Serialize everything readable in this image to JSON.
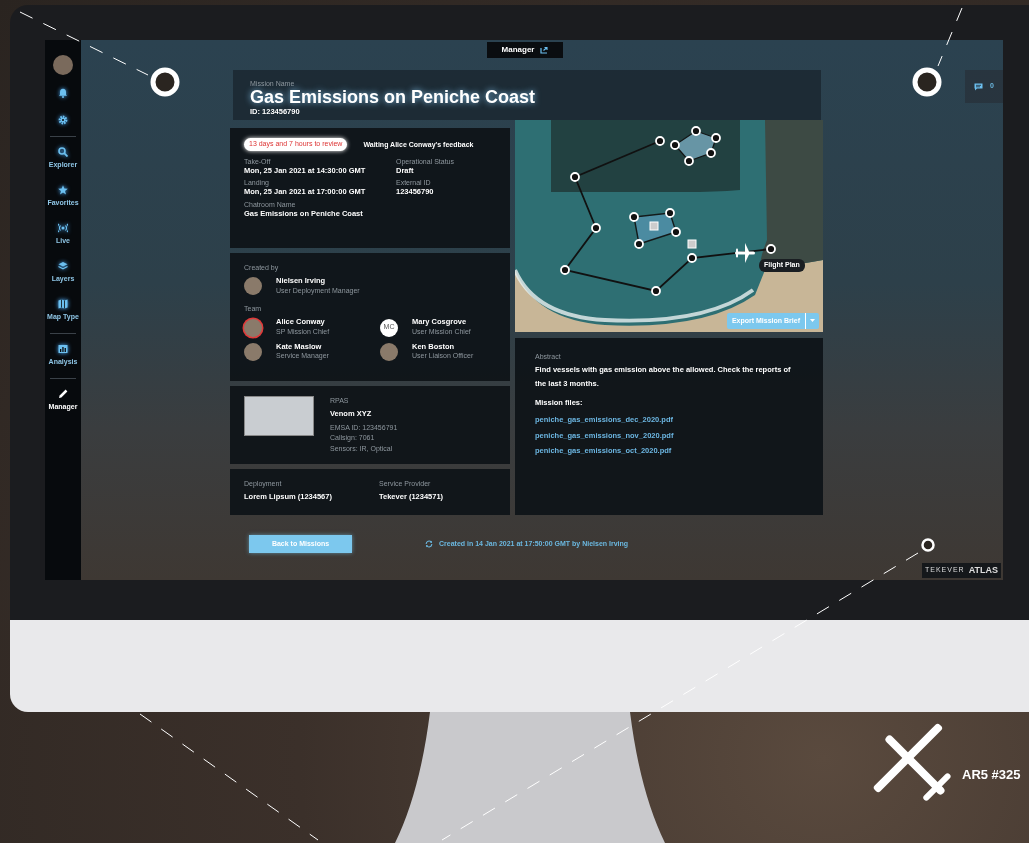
{
  "sidebar": {
    "items": [
      {
        "label": "Explorer",
        "selected": false
      },
      {
        "label": "Favorites",
        "selected": false
      },
      {
        "label": "Live",
        "selected": false
      },
      {
        "label": "Layers",
        "selected": false
      },
      {
        "label": "Map Type",
        "selected": false
      },
      {
        "label": "Analysis",
        "selected": false
      },
      {
        "label": "Manager",
        "selected": true
      }
    ]
  },
  "top_tab": {
    "label": "Manager"
  },
  "comments": {
    "count": "0"
  },
  "mission": {
    "name_label": "Mission Name",
    "name": "Gas Emissions on Peniche Coast",
    "id": "ID: 123456790"
  },
  "review": {
    "badge": "13 days and 7 hours to review",
    "status": "Waiting Alice Conway's feedback"
  },
  "details": [
    {
      "label": "Take-Off",
      "value": "Mon, 25 Jan 2021 at 14:30:00 GMT"
    },
    {
      "label": "Operational Status",
      "value": "Draft"
    },
    {
      "label": "Landing",
      "value": "Mon, 25 Jan 2021 at 17:00:00 GMT"
    },
    {
      "label": "External ID",
      "value": "123456790"
    },
    {
      "label": "Chatroom Name",
      "value": "Gas Emissions on Peniche Coast"
    }
  ],
  "created_by": {
    "label": "Created by",
    "name": "Nielsen Irving",
    "role": "User Deployment Manager"
  },
  "team": {
    "label": "Team",
    "members": [
      {
        "name": "Alice Conway",
        "role": "SP Mission Chief",
        "pending": true
      },
      {
        "name": "Mary Cosgrove",
        "role": "User Mission Chief",
        "initials": "MC",
        "pending": false
      },
      {
        "name": "Kate Maslow",
        "role": "Service Manager",
        "pending": false
      },
      {
        "name": "Ken Boston",
        "role": "User Liaison Officer",
        "pending": false
      }
    ]
  },
  "rpas": {
    "label": "RPAS",
    "name": "Venom XYZ",
    "lines": [
      "EMSA ID: 123456791",
      "Callsign: 7061",
      "Sensors: IR, Optical"
    ]
  },
  "deployment": [
    {
      "label": "Deployment",
      "value": "Lorem Lipsum  (1234567)"
    },
    {
      "label": "Service Provider",
      "value": "Tekever (1234571)"
    }
  ],
  "map": {
    "label": "Flight Plan",
    "export_button": "Export Mission Brief"
  },
  "abstract": {
    "label": "Abstract",
    "text": "Find vessels with gas emission above the allowed. Check the reports of the last 3 months.",
    "files_label": "Mission files:",
    "files": [
      "peniche_gas_emissions_dec_2020.pdf",
      "peniche_gas_emissions_nov_2020.pdf",
      "peniche_gas_emissions_oct_2020.pdf"
    ]
  },
  "footer": {
    "back_button": "Back to Missions",
    "created": "Created in 14 Jan 2021 at 17:50:00 GMT by Nielsen Irving"
  },
  "brand": {
    "logo": "TEKEVER",
    "product": "ATLAS"
  },
  "caption": {
    "text": "AR5 #325"
  }
}
